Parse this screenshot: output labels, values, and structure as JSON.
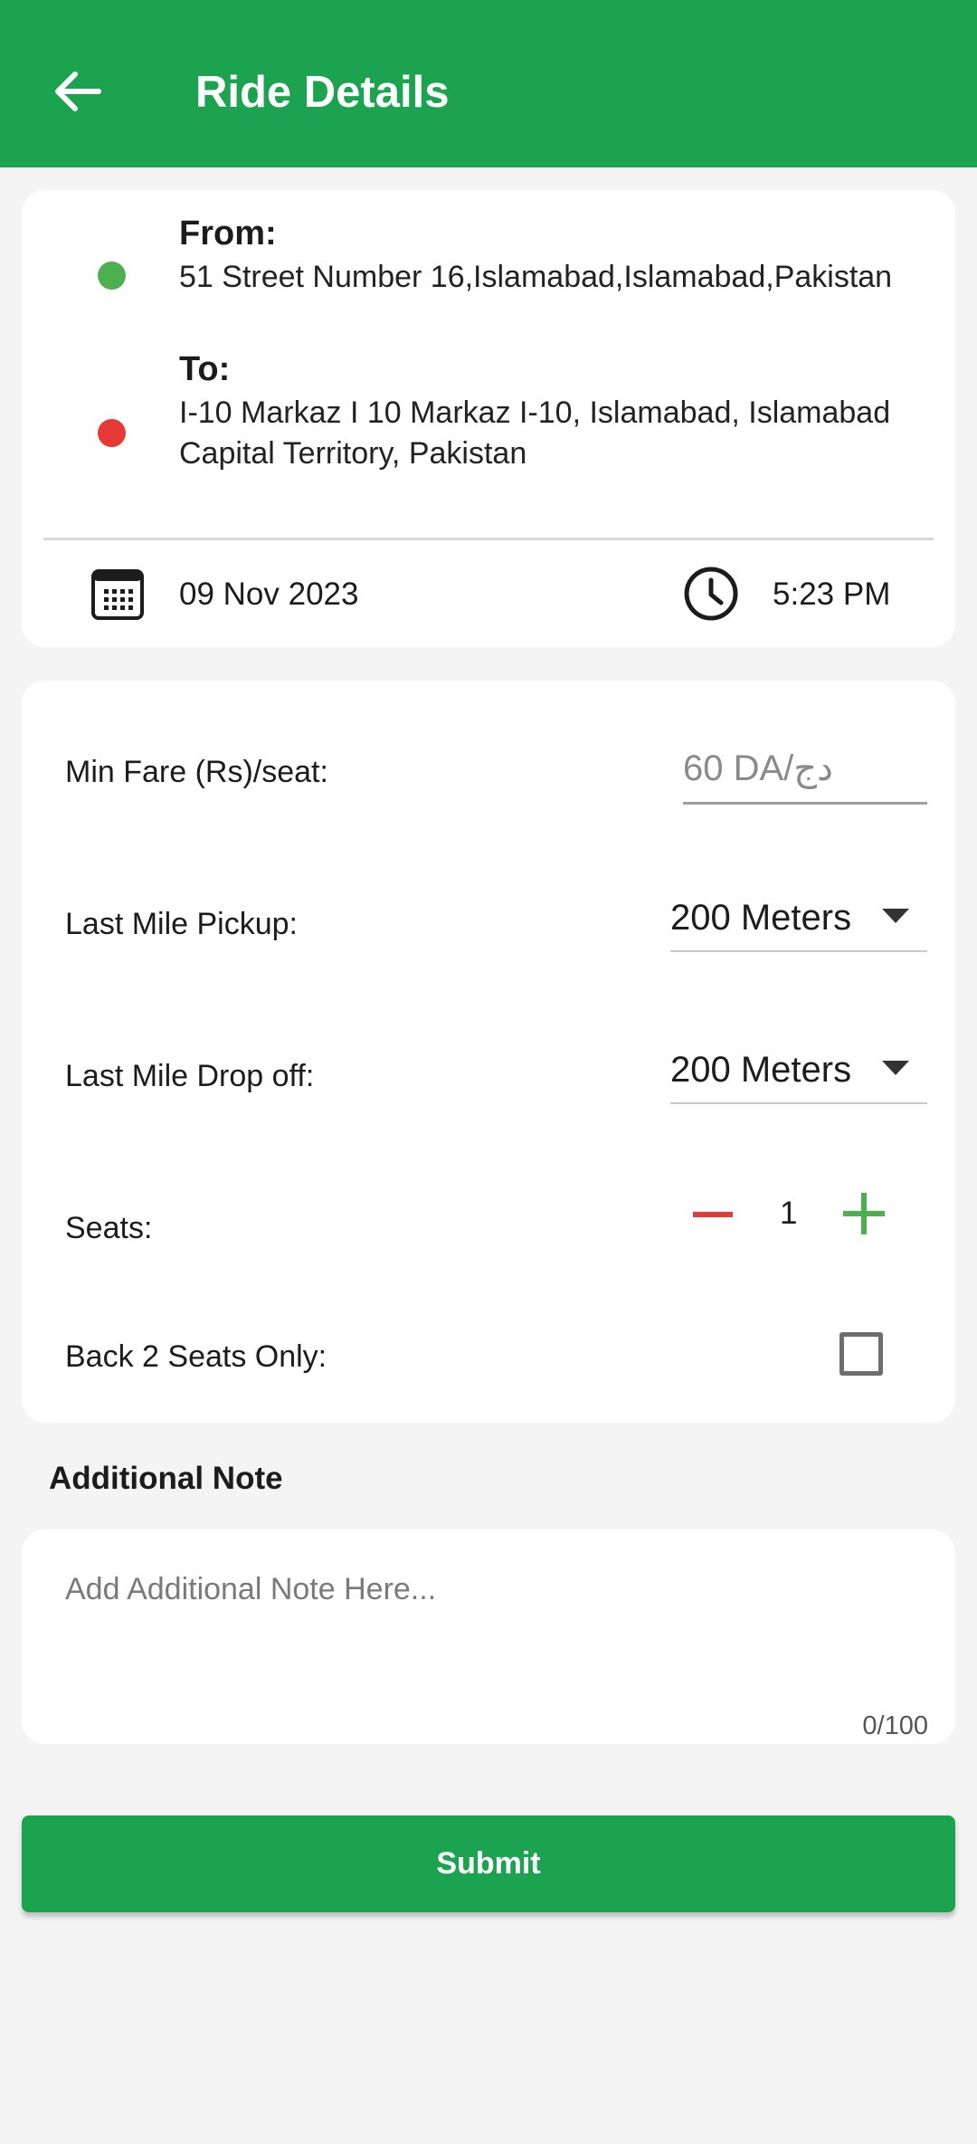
{
  "appbar": {
    "title": "Ride Details",
    "back_icon": "arrow-left-icon",
    "color": "#1ca34f"
  },
  "route": {
    "from_label": "From:",
    "from_address": "51 Street Number 16,Islamabad,Islamabad,Pakistan",
    "to_label": "To:",
    "to_address": "I-10 Markaz I 10 Markaz I-10, Islamabad, Islamabad Capital Territory, Pakistan",
    "date": "09 Nov 2023",
    "time": "5:23 PM",
    "from_dot_color": "#4caf50",
    "to_dot_color": "#e53935"
  },
  "options": {
    "min_fare_label": "Min Fare (Rs)/seat:",
    "min_fare_placeholder": "60 DA/دج",
    "last_mile_pickup_label": "Last Mile Pickup:",
    "last_mile_pickup_value": "200 Meters",
    "last_mile_dropoff_label": "Last Mile Drop off:",
    "last_mile_dropoff_value": "200 Meters",
    "seats_label": "Seats:",
    "seats_value": "1",
    "back_seats_label": "Back 2 Seats Only:",
    "back_seats_checked": false
  },
  "note": {
    "heading": "Additional Note",
    "placeholder": "Add Additional Note Here...",
    "counter": "0/100"
  },
  "submit": {
    "label": "Submit"
  }
}
